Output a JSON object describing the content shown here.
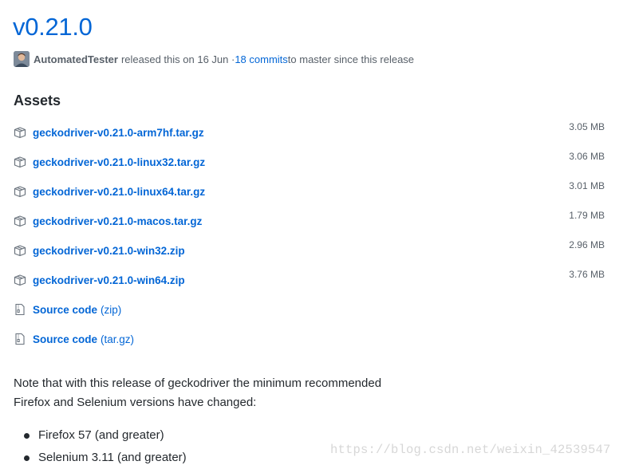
{
  "release": {
    "title": "v0.21.0",
    "author": "AutomatedTester",
    "released_text": "released this on 16 Jun · ",
    "commits_link": "18 commits",
    "since_text": " to master since this release"
  },
  "assets": {
    "heading": "Assets",
    "files": [
      {
        "name": "geckodriver-v0.21.0-arm7hf.tar.gz",
        "size": "3.05 MB",
        "icon": "package-icon"
      },
      {
        "name": "geckodriver-v0.21.0-linux32.tar.gz",
        "size": "3.06 MB",
        "icon": "package-icon"
      },
      {
        "name": "geckodriver-v0.21.0-linux64.tar.gz",
        "size": "3.01 MB",
        "icon": "package-icon"
      },
      {
        "name": "geckodriver-v0.21.0-macos.tar.gz",
        "size": "1.79 MB",
        "icon": "package-icon"
      },
      {
        "name": "geckodriver-v0.21.0-win32.zip",
        "size": "2.96 MB",
        "icon": "package-icon"
      },
      {
        "name": "geckodriver-v0.21.0-win64.zip",
        "size": "3.76 MB",
        "icon": "package-icon"
      }
    ],
    "source": [
      {
        "label": "Source code",
        "format": "(zip)",
        "icon": "file-zip-icon"
      },
      {
        "label": "Source code",
        "format": "(tar.gz)",
        "icon": "file-zip-icon"
      }
    ]
  },
  "notes": {
    "line1": "Note that with this release of geckodriver the minimum recommended",
    "line2": "Firefox and Selenium versions have changed:",
    "bullets": [
      "Firefox 57 (and greater)",
      "Selenium 3.11 (and greater)"
    ]
  },
  "watermark": "https://blog.csdn.net/weixin_42539547",
  "colors": {
    "link": "#0366d6",
    "text": "#24292e",
    "muted": "#586069"
  }
}
